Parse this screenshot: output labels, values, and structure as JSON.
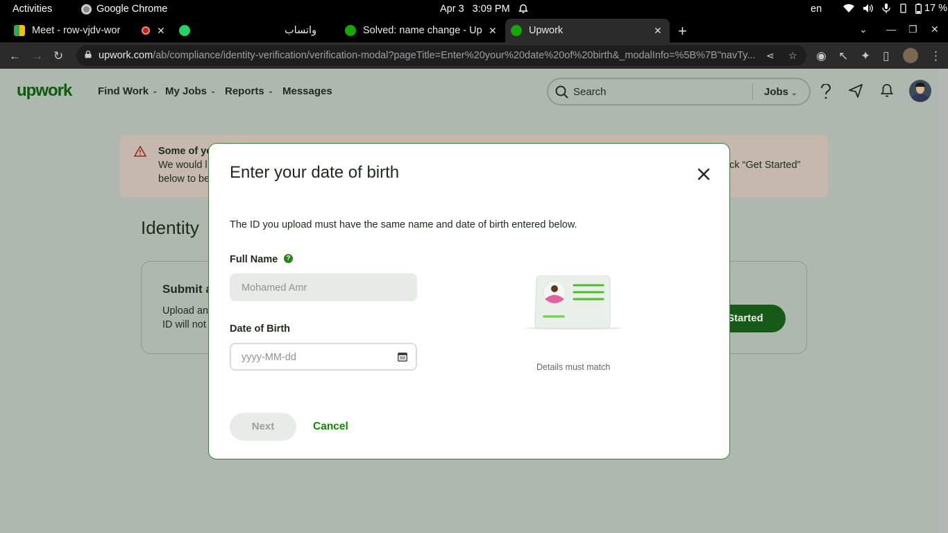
{
  "os_bar": {
    "activities": "Activities",
    "app": "Google Chrome",
    "date": "Apr 3",
    "time": "3:09 PM",
    "language": "en",
    "battery": "17 %"
  },
  "tabs": [
    {
      "title": "Meet - row-vjdv-wor",
      "favicon": "google-meet-icon"
    },
    {
      "title": "واتساب",
      "favicon": "whatsapp-icon"
    },
    {
      "title": "Solved: name change - Up",
      "favicon": "upwork-icon"
    },
    {
      "title": "Upwork",
      "favicon": "upwork-icon",
      "active": true
    }
  ],
  "address_bar": {
    "domain": "upwork.com",
    "path": "/ab/compliance/identity-verification/verification-modal?pageTitle=Enter%20your%20date%20of%20birth&_modalInfo=%5B%7B\"navTy..."
  },
  "upwork_header": {
    "logo": "upwork",
    "nav": [
      "Find Work",
      "My Jobs",
      "Reports",
      "Messages"
    ],
    "search_placeholder": "Search",
    "search_scope": "Jobs"
  },
  "banner": {
    "title": "Some of yo",
    "line1": "We would l",
    "line2": "below to be",
    "line1_right": "ck “Get Started”"
  },
  "identity": {
    "title": "Identity",
    "card_title": "Submit a",
    "card_line1": "Upload an",
    "card_line2": "ID will not",
    "button": "Started"
  },
  "modal": {
    "title": "Enter your date of birth",
    "description": "The ID you upload must have the same name and date of birth entered below.",
    "full_name_label": "Full Name",
    "full_name_value": "Mohamed Amr",
    "dob_label": "Date of Birth",
    "dob_placeholder": "yyyy-MM-dd",
    "illustration_caption": "Details must match",
    "next_label": "Next",
    "cancel_label": "Cancel"
  },
  "colors": {
    "upwork_green": "#108a00",
    "backdrop": "#afb8af",
    "banner_bg": "#c6b8ad"
  }
}
